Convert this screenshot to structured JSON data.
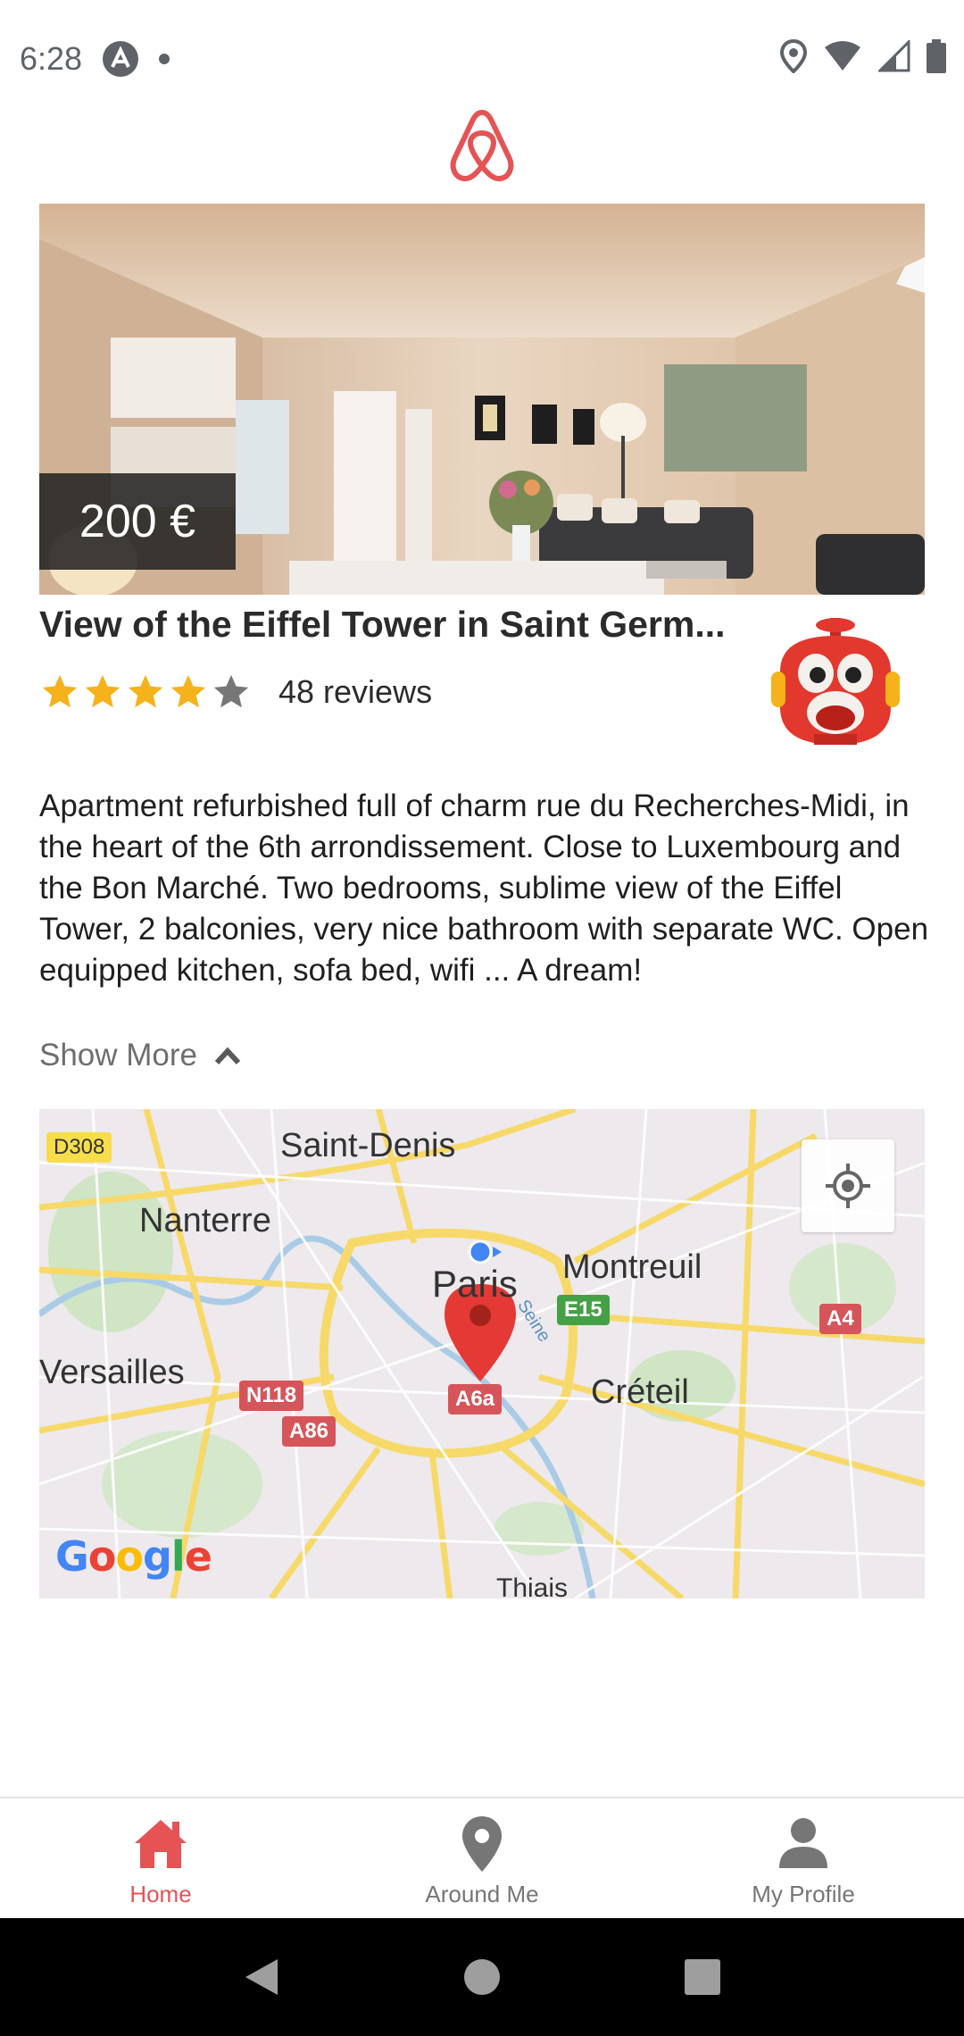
{
  "status_bar": {
    "time": "6:28"
  },
  "listing": {
    "price": "200 €",
    "title": "View of the Eiffel Tower in Saint Germ...",
    "rating": 4,
    "rating_max": 5,
    "reviews": "48 reviews",
    "description": "Apartment refurbished full of charm rue du Recherches-Midi, in the heart of the 6th arrondissement. Close to Luxembourg and the Bon Marché. Two bedrooms, sublime view of the Eiffel Tower, 2 balconies, very nice bathroom with separate WC. Open equipped kitchen, sofa bed, wifi ... A dream!",
    "show_more": "Show More"
  },
  "map": {
    "places": {
      "saint_denis": "Saint-Denis",
      "nanterre": "Nanterre",
      "montreuil": "Montreuil",
      "paris": "Paris",
      "versailles": "Versailles",
      "creteil": "Créteil",
      "thiais": "Thiais",
      "seine": "Seine"
    },
    "roads": {
      "d308": "D308",
      "e15": "E15",
      "a4": "A4",
      "n118": "N118",
      "a6a": "A6a",
      "a86": "A86"
    },
    "attribution": "Google"
  },
  "nav": {
    "items": [
      {
        "label": "Home",
        "icon": "home-icon",
        "active": true
      },
      {
        "label": "Around Me",
        "icon": "location-pin-icon",
        "active": false
      },
      {
        "label": "My Profile",
        "icon": "person-icon",
        "active": false
      }
    ]
  },
  "colors": {
    "brand": "#e55354",
    "star": "#f5b21b",
    "star_empty": "#777777"
  }
}
